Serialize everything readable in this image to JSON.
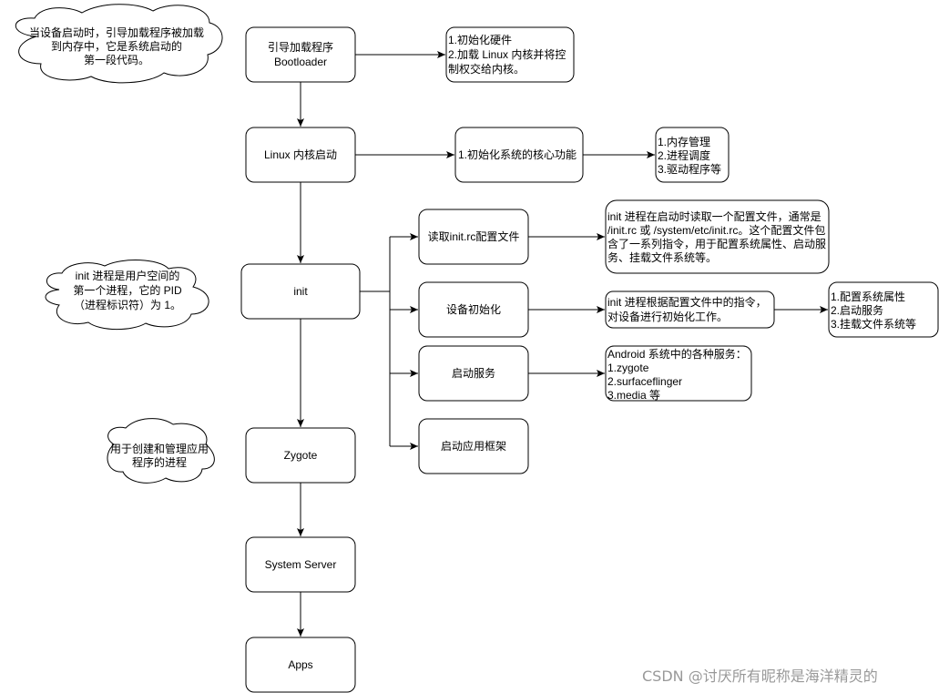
{
  "main_flow": {
    "bootloader": [
      "引导加载程序",
      "Bootloader"
    ],
    "linux": "Linux 内核启动",
    "init": "init",
    "zygote": "Zygote",
    "system_server": "System Server",
    "apps": "Apps"
  },
  "notes": {
    "bootloader_tasks": [
      "1.初始化硬件",
      "2.加载 Linux 内核并将控",
      "制权交给内核。"
    ],
    "linux_core": "1.初始化系统的核心功能",
    "kernel_list": [
      "1.内存管理",
      "2.进程调度",
      "3.驱动程序等"
    ],
    "init_rc_desc": [
      "init 进程在启动时读取一个配置文件，通常是",
      "/init.rc 或 /system/etc/init.rc。这个配置文件包",
      "含了一系列指令，用于配置系统属性、启动服",
      "务、挂载文件系统等。"
    ],
    "device_desc": [
      " init 进程根据配置文件中的指令，",
      "对设备进行初始化工作。"
    ],
    "config_list": [
      "1.配置系统属性",
      "2.启动服务",
      "3.挂载文件系统等"
    ],
    "services_list": [
      "Android 系统中的各种服务：",
      "1.zygote",
      "2.surfaceflinger",
      "3.media 等"
    ]
  },
  "init_steps": [
    "读取init.rc配置文件",
    "设备初始化",
    "启动服务",
    "启动应用框架"
  ],
  "clouds": {
    "bootloader": [
      "当设备启动时，引导加载程序被加载",
      "到内存中，它是系统启动的",
      "第一段代码。"
    ],
    "init": [
      "init 进程是用户空间的",
      "第一个进程，它的 PID",
      "（进程标识符）为 1。"
    ],
    "zygote": [
      "用于创建和管理应用",
      "程序的进程"
    ]
  },
  "watermark": "CSDN @讨厌所有昵称是海洋精灵的"
}
